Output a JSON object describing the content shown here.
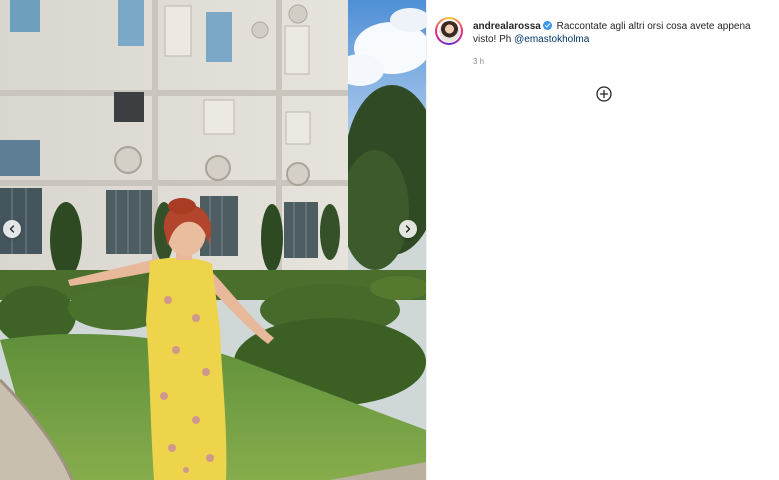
{
  "post": {
    "username": "andrealarossa",
    "verified": true,
    "caption_text": "Raccontate agli altri orsi cosa avete appena visto! Ph ",
    "mention": "@emastokholma",
    "timestamp": "3 h"
  },
  "icons": {
    "prev": "chevron-left-icon",
    "next": "chevron-right-icon",
    "load_more": "plus-circle-icon",
    "verified": "verified-badge-icon"
  },
  "colors": {
    "text": "#262626",
    "secondary_text": "#8e8e8e",
    "mention": "#00376b",
    "verified_badge": "#3897f0"
  }
}
